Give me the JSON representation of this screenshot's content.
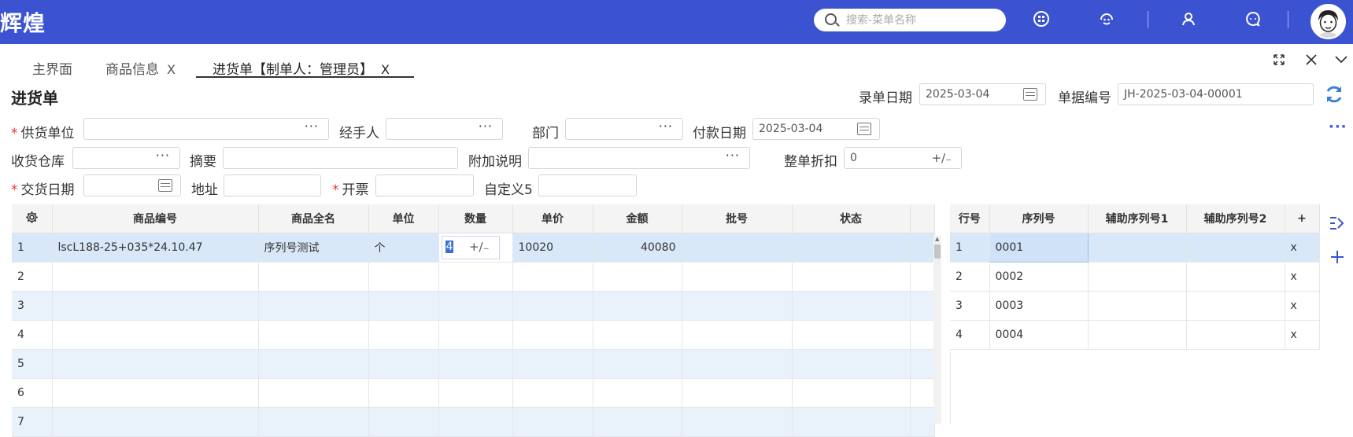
{
  "app": {
    "brand": "辉煌"
  },
  "search": {
    "placeholder": "搜索-菜单名称"
  },
  "tabs": [
    {
      "label": "主界面"
    },
    {
      "label": "商品信息",
      "close": "X"
    },
    {
      "label": "进货单【制单人：管理员】",
      "close": "X"
    }
  ],
  "page": {
    "title": "进货单"
  },
  "form": {
    "entry_date_label": "录单日期",
    "entry_date": "2025-03-04",
    "doc_no_label": "单据编号",
    "doc_no": "JH-2025-03-04-00001",
    "supplier_label": "供货单位",
    "handler_label": "经手人",
    "dept_label": "部门",
    "pay_date_label": "付款日期",
    "pay_date": "2025-03-04",
    "warehouse_label": "收货仓库",
    "summary_label": "摘要",
    "note_label": "附加说明",
    "discount_label": "整单折扣",
    "discount": "0",
    "delivery_date_label": "交货日期",
    "address_label": "地址",
    "invoice_label": "开票",
    "custom5_label": "自定义5",
    "required_mark": "*",
    "ellipsis": "···",
    "plusminus": "+∕₋"
  },
  "main_grid": {
    "columns": [
      "商品编号",
      "商品全名",
      "单位",
      "数量",
      "单价",
      "金额",
      "批号",
      "状态"
    ],
    "rows": [
      {
        "no": "1",
        "code": "lscL188-25+035*24.10.47",
        "name": "序列号测试",
        "unit": "个",
        "qty": "4",
        "price": "10020",
        "amount": "40080"
      },
      {
        "no": "2"
      },
      {
        "no": "3"
      },
      {
        "no": "4"
      },
      {
        "no": "5"
      },
      {
        "no": "6"
      },
      {
        "no": "7"
      }
    ]
  },
  "serial_grid": {
    "columns": [
      "行号",
      "序列号",
      "辅助序列号1",
      "辅助序列号2",
      "+"
    ],
    "rows": [
      {
        "no": "1",
        "serial": "0001",
        "del": "x"
      },
      {
        "no": "2",
        "serial": "0002",
        "del": "x"
      },
      {
        "no": "3",
        "serial": "0003",
        "del": "x"
      },
      {
        "no": "4",
        "serial": "0004",
        "del": "x"
      }
    ]
  },
  "colors": {
    "topbar": "#3b53d1",
    "row_alt": "#e9f1fb",
    "row_selected": "#d8e8f9",
    "accent": "#3b53d1"
  }
}
